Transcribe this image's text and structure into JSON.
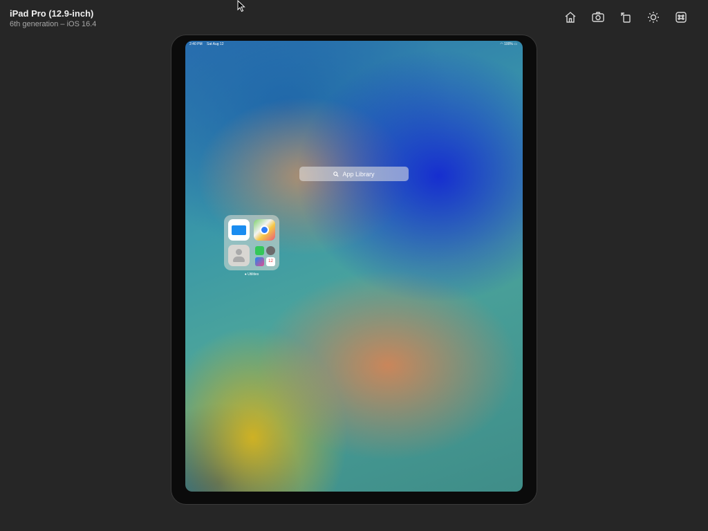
{
  "simulator": {
    "device_name": "iPad Pro (12.9-inch)",
    "device_subtitle": "6th generation – iOS 16.4"
  },
  "toolbar": {
    "icons": [
      "home-icon",
      "screenshot-icon",
      "rotate-icon",
      "brightness-icon",
      "command-icon"
    ]
  },
  "ipad": {
    "status_bar": {
      "time": "2:40 PM",
      "date": "Sat Aug 12",
      "battery": "100%"
    },
    "app_library": {
      "search_placeholder": "App Library",
      "folder_label": "Utilities",
      "folder_apps": [
        "Files",
        "Maps",
        "Contacts"
      ],
      "mini_apps": [
        "FaceTime",
        "Settings",
        "Shortcuts",
        "Calendar"
      ],
      "calendar_day": "12"
    }
  }
}
